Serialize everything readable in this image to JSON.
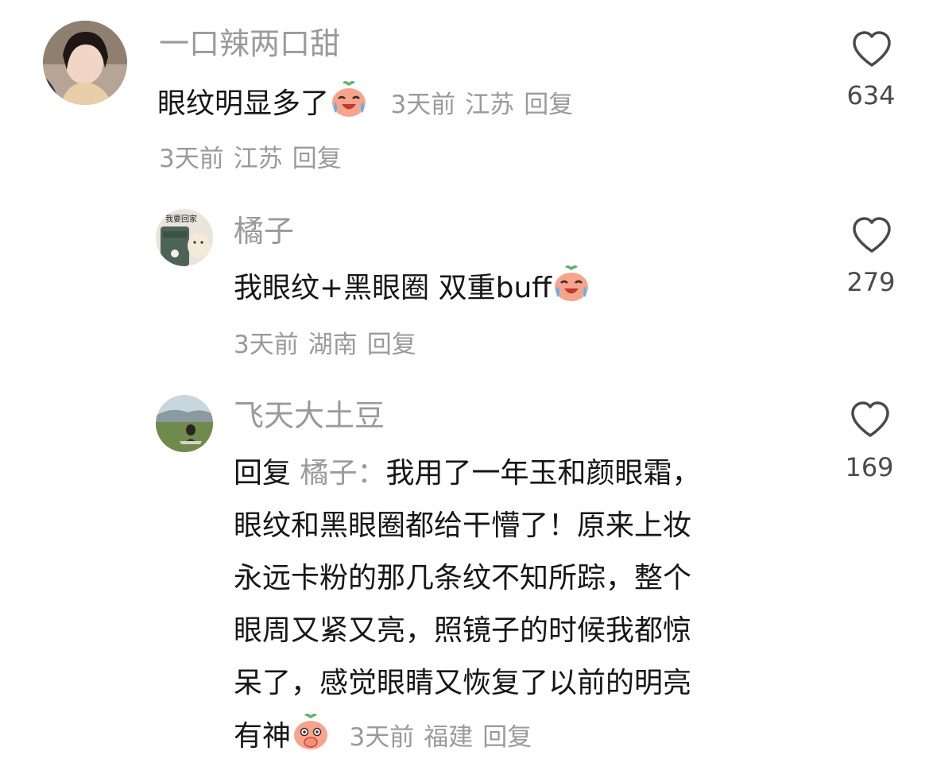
{
  "comments": [
    {
      "username": "一口辣两口甜",
      "text": "眼纹明显多了",
      "inline_meta": [
        "3天前",
        "江苏",
        "回复"
      ],
      "meta": [
        "3天前",
        "江苏",
        "回复"
      ],
      "likes": "634",
      "emoji": "crying-laugh-peach-emoji"
    },
    {
      "username": "橘子",
      "avatar_caption": "我要回家",
      "text": "我眼纹+黑眼圈 双重buff",
      "meta": [
        "3天前",
        "湖南",
        "回复"
      ],
      "likes": "279",
      "emoji": "crying-laugh-peach-emoji"
    },
    {
      "username": "飞天大土豆",
      "reply_label": "回复",
      "reply_target": "橘子：",
      "lines": [
        "我用了一年玉和颜眼霜，",
        "眼纹和黑眼圈都给干懵了！原来上妆",
        "永远卡粉的那几条纹不知所踪，整个",
        "眼周又紧又亮，照镜子的时候我都惊",
        "呆了，感觉眼睛又恢复了以前的明亮",
        "有神"
      ],
      "meta": [
        "3天前",
        "福建",
        "回复"
      ],
      "likes": "169",
      "emoji": "shy-peach-emoji"
    }
  ],
  "colors": {
    "text": "#161616",
    "secondary": "#9a9a9a",
    "background": "#ffffff"
  }
}
